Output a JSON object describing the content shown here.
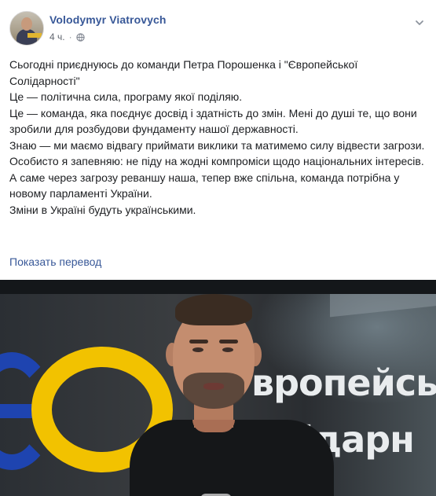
{
  "post": {
    "author": "Volodymyr Viatrovych",
    "time": "4 ч.",
    "separator": "·",
    "audience_icon": "globe-icon",
    "menu_icon": "chevron-down-icon",
    "paragraphs": [
      "Сьогодні приєднуюсь до команди Петра Порошенка і \"Європейської Солідарності\"",
      "Це — політична сила, програму якої поділяю.",
      "Це — команда, яка поєднує досвід і здатність до змін. Мені до душі те, що вони зробили для розбудови фундаменту нашої державності.",
      "Знаю — ми маємо відвагу приймати виклики та матимемо силу відвести загрози.",
      "Особисто я запевняю: не піду на жодні компроміси щодо національних інтересів.",
      "А саме через загрозу реваншу наша, тепер вже спільна, команда потрібна у новому парламенті України.",
      "Зміни в Україні будуть українськими."
    ],
    "translate_link": "Показать перевод"
  },
  "photo": {
    "sign_line1": "вропейсь",
    "sign_line2": "олідарн",
    "colors": {
      "blue": "#1e44b0",
      "yellow": "#f2c200",
      "link": "#385898"
    }
  }
}
